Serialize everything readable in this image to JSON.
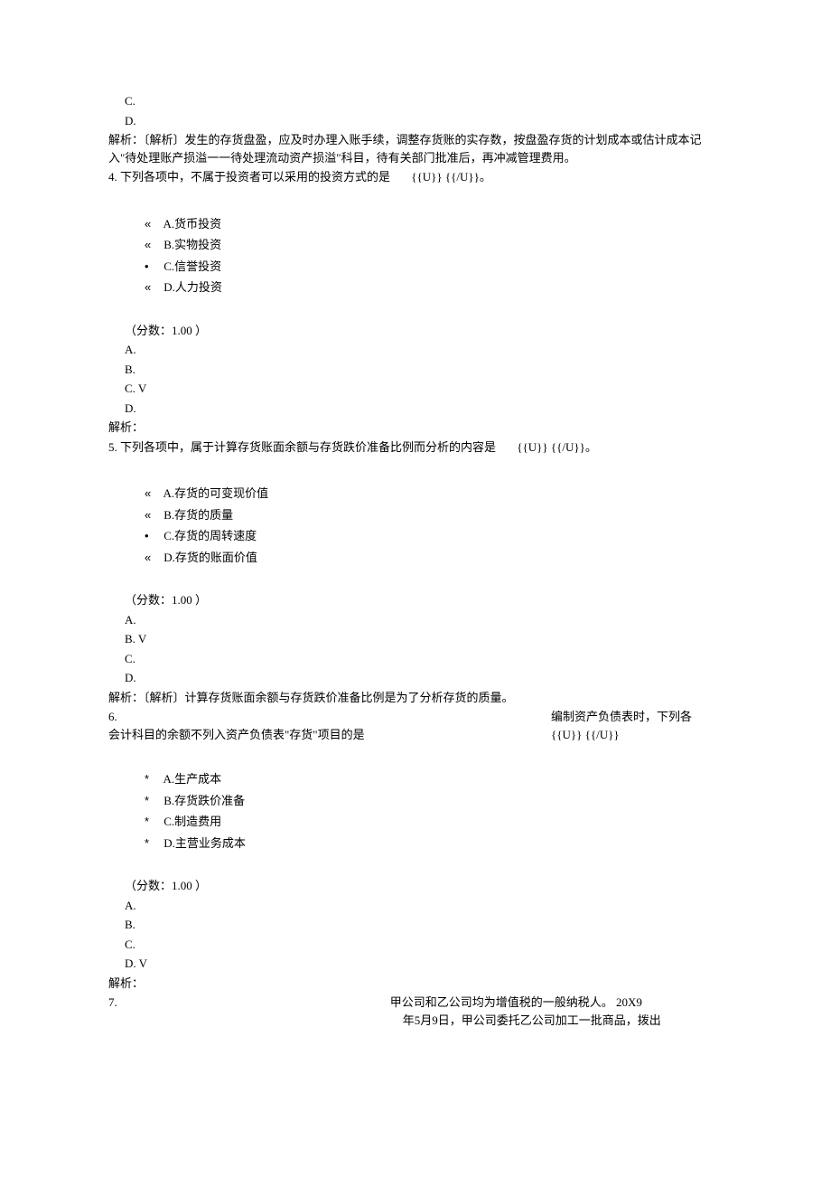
{
  "prev_answers": {
    "c": "C.",
    "d": "D."
  },
  "q3_explain": "解析：〔解析〕发生的存货盘盈，应及时办理入账手续，调整存货账的实存数，按盘盈存货的计划成本或估计成本记入\"待处理账产损溢一一待处理流动资产损溢\"科目，待有关部门批准后，再冲减管理费用。",
  "q4": {
    "stem_left": "4.  下列各项中，不属于投资者可以采用的投资方式的是",
    "tag": "{{U}} {{/U}}。",
    "bullet1": "«",
    "opt_a": "A.货币投资",
    "bullet2": "«",
    "opt_b": "B.实物投资",
    "bullet3": "•",
    "opt_c": "C.信誉投资",
    "bullet4": "«",
    "opt_d": "D.人力投资",
    "score": "（分数：1.00 ）",
    "a": "A.",
    "b": "B.",
    "c": "C.    V",
    "d": "D.",
    "explain": "解析："
  },
  "q5": {
    "stem_left": "5.  下列各项中，属于计算存货账面余额与存货跌价准备比例而分析的内容是",
    "tag": "{{U}} {{/U}}。",
    "bullet1": "«",
    "opt_a": "A.存货的可变现价值",
    "bullet2": "«",
    "opt_b": "B.存货的质量",
    "bullet3": "•",
    "opt_c": "C.存货的周转速度",
    "bullet4": "«",
    "opt_d": "D.存货的账面价值",
    "score": "（分数：1.00 ）",
    "a": "A.",
    "b": "B.    V",
    "c": "C.",
    "d": "D.",
    "explain": "解析：〔解析〕计算存货账面余额与存货跌价准备比例是为了分析存货的质量。"
  },
  "q6": {
    "num": "6.",
    "right1": "编制资产负债表时，下列各",
    "left2": "会计科目的余额不列入资产负债表\"存货\"项目的是",
    "right2": "{{U}} {{/U}}",
    "bullet1": "*",
    "opt_a": "A.生产成本",
    "bullet2": "*",
    "opt_b": "B.存货跌价准备",
    "bullet3": "*",
    "opt_c": "C.制造费用",
    "bullet4": "*",
    "opt_d": "D.主营业务成本",
    "score": "（分数：1.00 ）",
    "a": "A.",
    "b": "B.",
    "c": "C.",
    "d": "D.    V",
    "explain": "解析："
  },
  "q7": {
    "num": "7.",
    "right1": "甲公司和乙公司均为增值税的一般纳税人。     20X9",
    "right2": "年5月9日，甲公司委托乙公司加工一批商品，拨出"
  }
}
